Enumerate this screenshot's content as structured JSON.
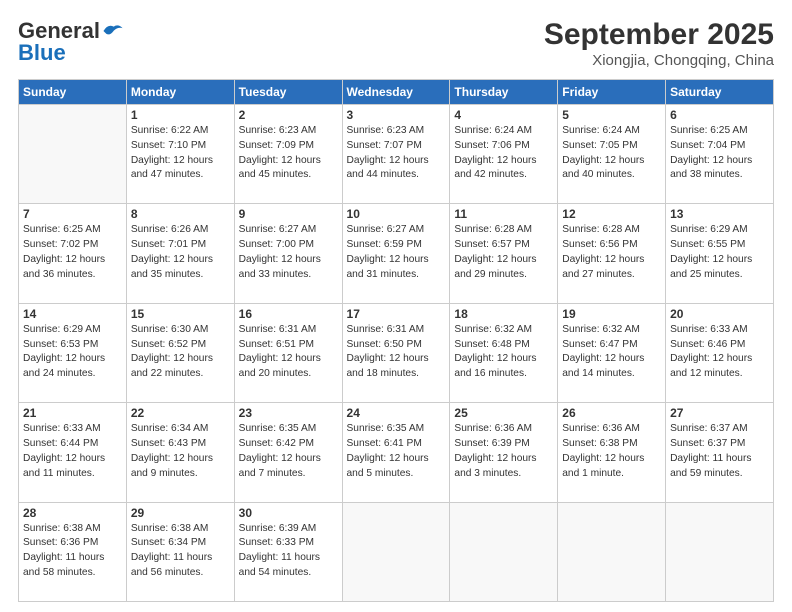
{
  "logo": {
    "general": "General",
    "blue": "Blue"
  },
  "header": {
    "month": "September 2025",
    "location": "Xiongjia, Chongqing, China"
  },
  "weekdays": [
    "Sunday",
    "Monday",
    "Tuesday",
    "Wednesday",
    "Thursday",
    "Friday",
    "Saturday"
  ],
  "weeks": [
    [
      {
        "day": "",
        "info": ""
      },
      {
        "day": "1",
        "info": "Sunrise: 6:22 AM\nSunset: 7:10 PM\nDaylight: 12 hours\nand 47 minutes."
      },
      {
        "day": "2",
        "info": "Sunrise: 6:23 AM\nSunset: 7:09 PM\nDaylight: 12 hours\nand 45 minutes."
      },
      {
        "day": "3",
        "info": "Sunrise: 6:23 AM\nSunset: 7:07 PM\nDaylight: 12 hours\nand 44 minutes."
      },
      {
        "day": "4",
        "info": "Sunrise: 6:24 AM\nSunset: 7:06 PM\nDaylight: 12 hours\nand 42 minutes."
      },
      {
        "day": "5",
        "info": "Sunrise: 6:24 AM\nSunset: 7:05 PM\nDaylight: 12 hours\nand 40 minutes."
      },
      {
        "day": "6",
        "info": "Sunrise: 6:25 AM\nSunset: 7:04 PM\nDaylight: 12 hours\nand 38 minutes."
      }
    ],
    [
      {
        "day": "7",
        "info": "Sunrise: 6:25 AM\nSunset: 7:02 PM\nDaylight: 12 hours\nand 36 minutes."
      },
      {
        "day": "8",
        "info": "Sunrise: 6:26 AM\nSunset: 7:01 PM\nDaylight: 12 hours\nand 35 minutes."
      },
      {
        "day": "9",
        "info": "Sunrise: 6:27 AM\nSunset: 7:00 PM\nDaylight: 12 hours\nand 33 minutes."
      },
      {
        "day": "10",
        "info": "Sunrise: 6:27 AM\nSunset: 6:59 PM\nDaylight: 12 hours\nand 31 minutes."
      },
      {
        "day": "11",
        "info": "Sunrise: 6:28 AM\nSunset: 6:57 PM\nDaylight: 12 hours\nand 29 minutes."
      },
      {
        "day": "12",
        "info": "Sunrise: 6:28 AM\nSunset: 6:56 PM\nDaylight: 12 hours\nand 27 minutes."
      },
      {
        "day": "13",
        "info": "Sunrise: 6:29 AM\nSunset: 6:55 PM\nDaylight: 12 hours\nand 25 minutes."
      }
    ],
    [
      {
        "day": "14",
        "info": "Sunrise: 6:29 AM\nSunset: 6:53 PM\nDaylight: 12 hours\nand 24 minutes."
      },
      {
        "day": "15",
        "info": "Sunrise: 6:30 AM\nSunset: 6:52 PM\nDaylight: 12 hours\nand 22 minutes."
      },
      {
        "day": "16",
        "info": "Sunrise: 6:31 AM\nSunset: 6:51 PM\nDaylight: 12 hours\nand 20 minutes."
      },
      {
        "day": "17",
        "info": "Sunrise: 6:31 AM\nSunset: 6:50 PM\nDaylight: 12 hours\nand 18 minutes."
      },
      {
        "day": "18",
        "info": "Sunrise: 6:32 AM\nSunset: 6:48 PM\nDaylight: 12 hours\nand 16 minutes."
      },
      {
        "day": "19",
        "info": "Sunrise: 6:32 AM\nSunset: 6:47 PM\nDaylight: 12 hours\nand 14 minutes."
      },
      {
        "day": "20",
        "info": "Sunrise: 6:33 AM\nSunset: 6:46 PM\nDaylight: 12 hours\nand 12 minutes."
      }
    ],
    [
      {
        "day": "21",
        "info": "Sunrise: 6:33 AM\nSunset: 6:44 PM\nDaylight: 12 hours\nand 11 minutes."
      },
      {
        "day": "22",
        "info": "Sunrise: 6:34 AM\nSunset: 6:43 PM\nDaylight: 12 hours\nand 9 minutes."
      },
      {
        "day": "23",
        "info": "Sunrise: 6:35 AM\nSunset: 6:42 PM\nDaylight: 12 hours\nand 7 minutes."
      },
      {
        "day": "24",
        "info": "Sunrise: 6:35 AM\nSunset: 6:41 PM\nDaylight: 12 hours\nand 5 minutes."
      },
      {
        "day": "25",
        "info": "Sunrise: 6:36 AM\nSunset: 6:39 PM\nDaylight: 12 hours\nand 3 minutes."
      },
      {
        "day": "26",
        "info": "Sunrise: 6:36 AM\nSunset: 6:38 PM\nDaylight: 12 hours\nand 1 minute."
      },
      {
        "day": "27",
        "info": "Sunrise: 6:37 AM\nSunset: 6:37 PM\nDaylight: 11 hours\nand 59 minutes."
      }
    ],
    [
      {
        "day": "28",
        "info": "Sunrise: 6:38 AM\nSunset: 6:36 PM\nDaylight: 11 hours\nand 58 minutes."
      },
      {
        "day": "29",
        "info": "Sunrise: 6:38 AM\nSunset: 6:34 PM\nDaylight: 11 hours\nand 56 minutes."
      },
      {
        "day": "30",
        "info": "Sunrise: 6:39 AM\nSunset: 6:33 PM\nDaylight: 11 hours\nand 54 minutes."
      },
      {
        "day": "",
        "info": ""
      },
      {
        "day": "",
        "info": ""
      },
      {
        "day": "",
        "info": ""
      },
      {
        "day": "",
        "info": ""
      }
    ]
  ]
}
